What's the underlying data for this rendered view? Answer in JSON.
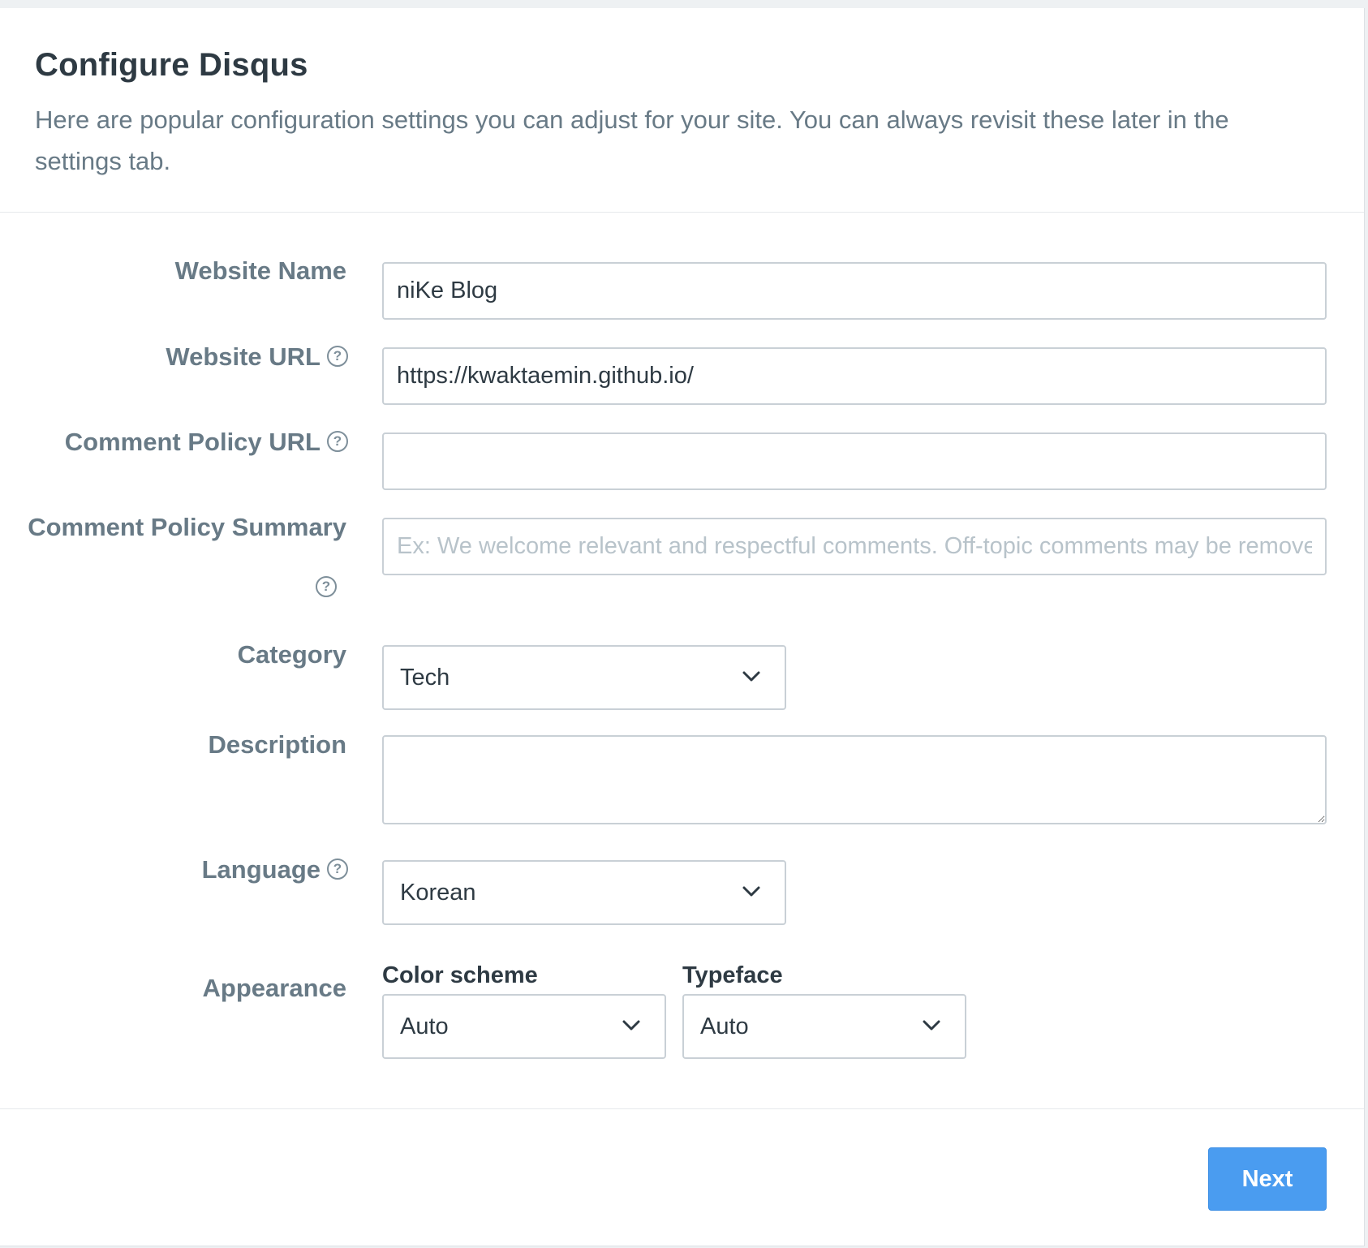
{
  "header": {
    "title": "Configure Disqus",
    "subtitle": "Here are popular configuration settings you can adjust for your site. You can always revisit these later in the settings tab."
  },
  "form": {
    "website_name": {
      "label": "Website Name",
      "value": "niKe Blog"
    },
    "website_url": {
      "label": "Website URL",
      "value": "https://kwaktaemin.github.io/",
      "help_icon": "question-circle-icon"
    },
    "comment_policy_url": {
      "label": "Comment Policy URL",
      "value": "",
      "help_icon": "question-circle-icon"
    },
    "comment_policy_summary": {
      "label": "Comment Policy Summary",
      "value": "",
      "placeholder": "Ex: We welcome relevant and respectful comments. Off-topic comments may be removed.",
      "help_icon": "question-circle-icon"
    },
    "category": {
      "label": "Category",
      "selected": "Tech",
      "icon": "chevron-down-icon"
    },
    "description": {
      "label": "Description",
      "value": ""
    },
    "language": {
      "label": "Language",
      "selected": "Korean",
      "help_icon": "question-circle-icon",
      "icon": "chevron-down-icon"
    },
    "appearance": {
      "label": "Appearance",
      "color_scheme": {
        "label": "Color scheme",
        "selected": "Auto"
      },
      "typeface": {
        "label": "Typeface",
        "selected": "Auto"
      }
    },
    "help_glyph": "?"
  },
  "footer": {
    "next_label": "Next"
  },
  "colors": {
    "accent": "#4a9cf0",
    "label_text": "#687a86",
    "input_border": "#c9d0d6"
  }
}
